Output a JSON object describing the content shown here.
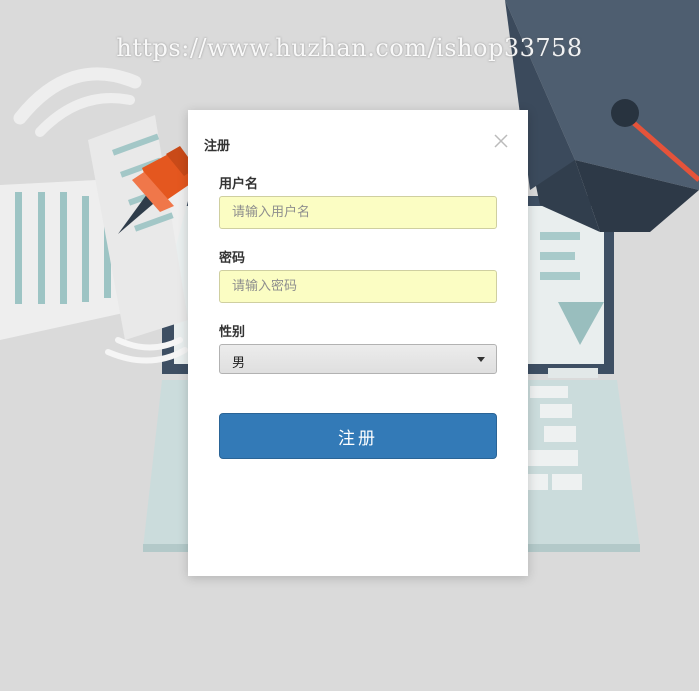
{
  "watermark": "https://www.huzhan.com/ishop33758",
  "modal": {
    "title": "注册",
    "username": {
      "label": "用户名",
      "placeholder": "请输入用户名",
      "value": ""
    },
    "password": {
      "label": "密码",
      "placeholder": "请输入密码",
      "value": ""
    },
    "gender": {
      "label": "性别",
      "selected": "男"
    },
    "submit_label": "注册"
  },
  "icons": {
    "close": "close-icon",
    "dropdown": "caret-down-icon"
  },
  "colors": {
    "page_background": "#dadada",
    "primary_button": "#337ab7",
    "input_autofill": "#fbfdc3",
    "cap_dark": "#3b4a5c",
    "pin_orange": "#e4571f",
    "laptop_teal": "#cbdcdc"
  }
}
